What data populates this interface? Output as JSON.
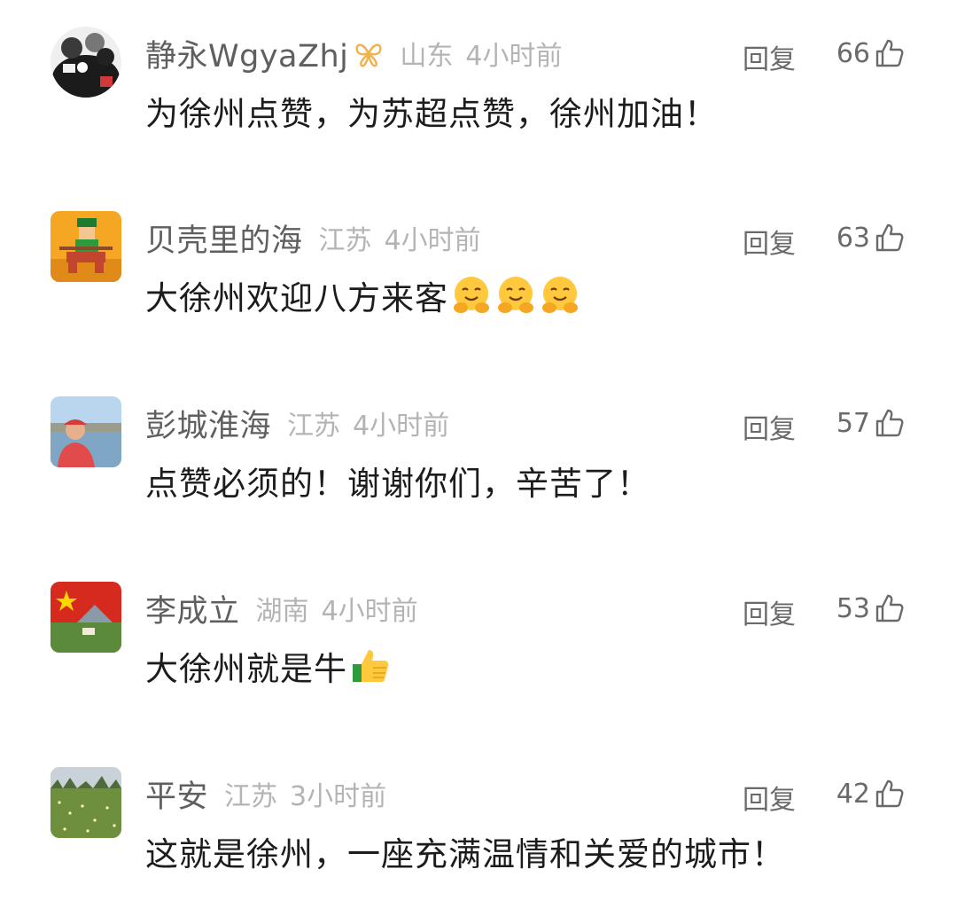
{
  "reply_label": "回复",
  "comments": [
    {
      "username": "静永WgyaZhj",
      "location": "山东",
      "time": "4小时前",
      "likes": "66",
      "text": "为徐州点赞，为苏超点赞，徐州加油！",
      "avatar_icon": "monochrome-group-avatar",
      "badge_icon": "butterfly-icon"
    },
    {
      "username": "贝壳里的海",
      "location": "江苏",
      "time": "4小时前",
      "likes": "63",
      "text": "大徐州欢迎八方来客",
      "avatar_icon": "pixel-art-warrior-avatar",
      "emoji_icon": "hugging-face-emoji",
      "emoji_count": 3
    },
    {
      "username": "彭城淮海",
      "location": "江苏",
      "time": "4小时前",
      "likes": "57",
      "text": "点赞必须的！谢谢你们，辛苦了！",
      "avatar_icon": "man-in-red-cap-avatar"
    },
    {
      "username": "李成立",
      "location": "湖南",
      "time": "4小时前",
      "likes": "53",
      "text": "大徐州就是牛",
      "avatar_icon": "flag-landscape-avatar",
      "emoji_icon": "thumbs-up-emoji",
      "emoji_count": 1
    },
    {
      "username": "平安",
      "location": "江苏",
      "time": "3小时前",
      "likes": "42",
      "text": "这就是徐州，一座充满温情和关爱的城市！",
      "avatar_icon": "flower-field-avatar"
    }
  ],
  "colors": {
    "username": "#5f5f5f",
    "meta": "#b4b4b4",
    "body_text": "#1c1c1c",
    "action": "#6a6a6a"
  }
}
